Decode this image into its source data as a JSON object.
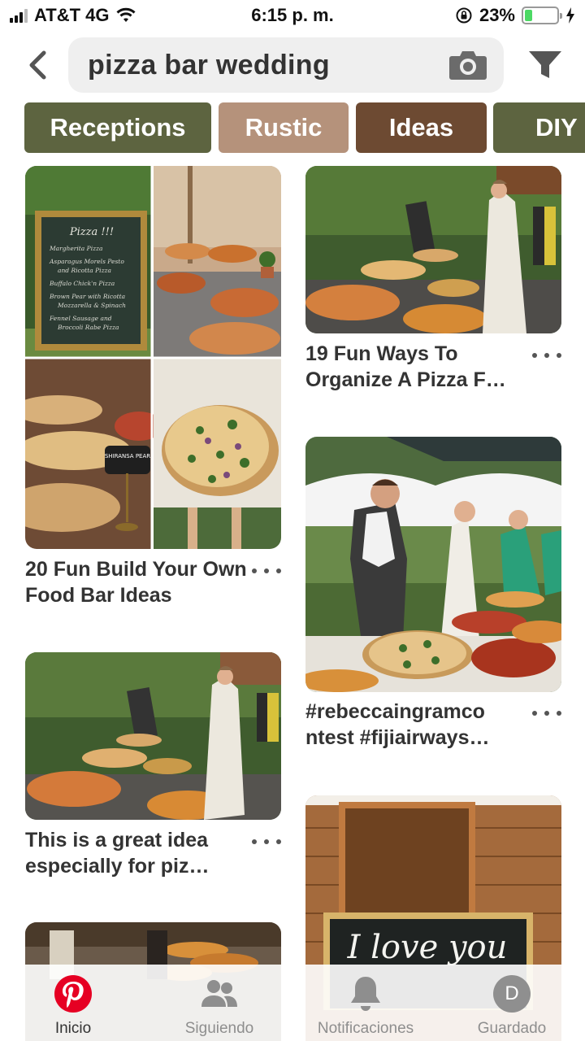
{
  "status_bar": {
    "carrier": "AT&T 4G",
    "time": "6:15 p. m.",
    "battery_percent": "23%",
    "battery_level": 0.23,
    "icons": [
      "signal-icon",
      "wifi-icon",
      "rotation-lock-icon",
      "battery-icon",
      "charging-icon"
    ]
  },
  "search": {
    "query": "pizza bar wedding",
    "icons": [
      "back-arrow-icon",
      "camera-icon",
      "filter-icon"
    ]
  },
  "chips": [
    {
      "label": "Receptions",
      "color": "#5d6440"
    },
    {
      "label": "Rustic",
      "color": "#b5927b"
    },
    {
      "label": "Ideas",
      "color": "#6d4a32"
    },
    {
      "label": "DIY",
      "color": "#5d6440"
    }
  ],
  "pins": {
    "col1": [
      {
        "title": "20 Fun Build Your Own Food Bar Ideas"
      },
      {
        "title": "This is a great idea especially for piz…"
      }
    ],
    "col2": [
      {
        "title": "19 Fun Ways To Organize A Pizza F…"
      },
      {
        "title": "#rebeccaingramco ntest #fijiairways…"
      }
    ],
    "chalkboard_menu": {
      "heading": "Pizza !!!",
      "lines": [
        "Margherita Pizza",
        "Asparagus Morels Pesto",
        "and Ricotta Pizza",
        "Buffalo Chick'n Pizza",
        "Brown Pear with Ricotta",
        "Mozzarella & Spinach",
        "Fennel Sausage and",
        "Broccoli Rabe Pizza"
      ]
    },
    "sign_label": "SHIRANSA PEAR",
    "last_pin_sign": "I love you"
  },
  "tabs": [
    {
      "label": "Inicio",
      "icon": "pinterest-logo-icon",
      "active": true
    },
    {
      "label": "Siguiendo",
      "icon": "people-icon",
      "active": false
    },
    {
      "label": "Notificaciones",
      "icon": "bell-icon",
      "active": false
    },
    {
      "label": "Guardado",
      "icon": "avatar-icon",
      "avatar_letter": "D",
      "active": false
    }
  ]
}
